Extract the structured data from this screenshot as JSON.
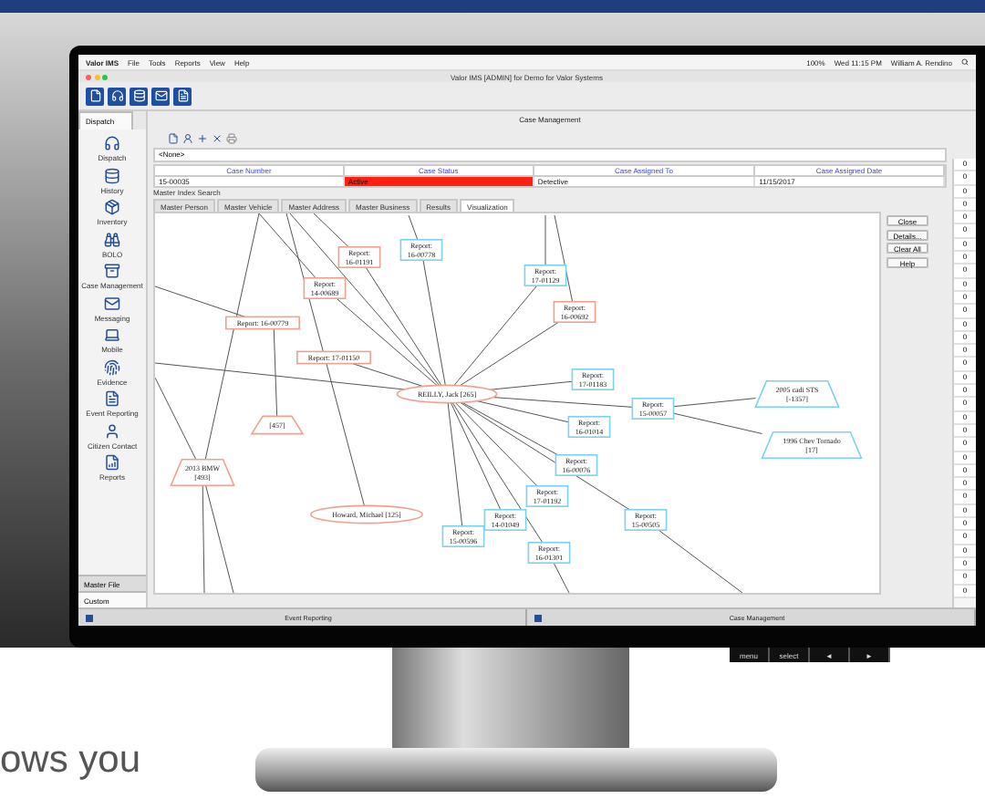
{
  "menubar": {
    "items": [
      "Valor IMS",
      "File",
      "Tools",
      "Reports",
      "View",
      "Help"
    ],
    "status": [
      "100%",
      "Wed 11:15 PM",
      "William A. Rendino"
    ]
  },
  "window": {
    "title": "Valor IMS [ADMIN] for Demo for Valor Systems"
  },
  "sidebar": {
    "tabs": [
      {
        "label": "Dispatch",
        "selected": true
      }
    ],
    "items": [
      "Dispatch",
      "History",
      "Inventory",
      "BOLO",
      "Case Management",
      "Messaging",
      "Mobile",
      "Evidence",
      "Event Reporting",
      "Citizen Contact",
      "Reports"
    ],
    "bottom_tabs": [
      {
        "label": "Master File",
        "selected": false
      },
      {
        "label": "Custom",
        "selected": true
      }
    ]
  },
  "case_management": {
    "title": "Case Management",
    "filter": "<None>",
    "columns": [
      "Case Number",
      "Case Status",
      "Case Assigned To",
      "Case Assigned Date"
    ],
    "rows": [
      {
        "cells": [
          "15-00035",
          "Active",
          "Detective",
          "11/15/2017"
        ],
        "color": "#ff2010"
      }
    ],
    "search_title": "Master Index Search",
    "tabs": [
      {
        "label": "Master Person",
        "selected": false
      },
      {
        "label": "Master Vehicle",
        "selected": false
      },
      {
        "label": "Master Address",
        "selected": false
      },
      {
        "label": "Master Business",
        "selected": false
      },
      {
        "label": "Results",
        "selected": false
      },
      {
        "label": "Visualization",
        "selected": true
      }
    ],
    "buttons": [
      "Close",
      "Details...",
      "Clear All",
      "Help"
    ],
    "counts": [
      "0",
      "0",
      "0",
      "0",
      "0",
      "0",
      "0",
      "0",
      "0",
      "0",
      "0",
      "0",
      "0",
      "0",
      "0",
      "0",
      "0",
      "0",
      "0",
      "0",
      "0",
      "0",
      "0",
      "0",
      "0",
      "0",
      "0",
      "0",
      "0",
      "0",
      "0",
      "0",
      "0"
    ]
  },
  "graph": {
    "nodes": [
      {
        "kind": "box",
        "lines": [
          "Report:",
          "16-01191"
        ],
        "color": "#f0a08c"
      },
      {
        "kind": "box",
        "lines": [
          "Report:",
          "16-00778"
        ],
        "color": "#78d2f0"
      },
      {
        "kind": "box",
        "lines": [
          "Report:",
          "14-00689"
        ],
        "color": "#f0a08c"
      },
      {
        "kind": "box",
        "lines": [
          "Report: 16-00779"
        ],
        "color": "#f0a08c"
      },
      {
        "kind": "box",
        "lines": [
          "Report: 17-01150"
        ],
        "color": "#f0a08c"
      },
      {
        "kind": "ellipse",
        "lines": [
          "REILLY, Jack [265]"
        ],
        "color": "#f0a08c"
      },
      {
        "kind": "trapezoid",
        "lines": [
          "[457]"
        ],
        "color": "#f0a08c"
      },
      {
        "kind": "trapezoid",
        "lines": [
          "2013 BMW",
          "[493]"
        ],
        "color": "#f0a08c"
      },
      {
        "kind": "ellipse",
        "lines": [
          "Howard, Michael [125]"
        ],
        "color": "#f0a08c"
      },
      {
        "kind": "box",
        "lines": [
          "Report:",
          "15-00596"
        ],
        "color": "#78d2f0"
      },
      {
        "kind": "box",
        "lines": [
          "Report:",
          "14-01049"
        ],
        "color": "#78d2f0"
      },
      {
        "kind": "box",
        "lines": [
          "Report:",
          "17-01129"
        ],
        "color": "#78d2f0"
      },
      {
        "kind": "box",
        "lines": [
          "Report:",
          "16-00692"
        ],
        "color": "#f0a08c"
      },
      {
        "kind": "box",
        "lines": [
          "Report:",
          "17-01183"
        ],
        "color": "#78d2f0"
      },
      {
        "kind": "box",
        "lines": [
          "Report:",
          "15-00057"
        ],
        "color": "#78d2f0"
      },
      {
        "kind": "box",
        "lines": [
          "Report:",
          "16-01014"
        ],
        "color": "#78d2f0"
      },
      {
        "kind": "box",
        "lines": [
          "Report:",
          "16-00076"
        ],
        "color": "#78d2f0"
      },
      {
        "kind": "box",
        "lines": [
          "Report:",
          "17-01192"
        ],
        "color": "#78d2f0"
      },
      {
        "kind": "box",
        "lines": [
          "Report:",
          "16-01301"
        ],
        "color": "#78d2f0"
      },
      {
        "kind": "box",
        "lines": [
          "Report:",
          "15-00505"
        ],
        "color": "#78d2f0"
      },
      {
        "kind": "trapezoid",
        "lines": [
          "2005 cadi STS",
          "[-1357]"
        ],
        "color": "#78d2f0"
      },
      {
        "kind": "trapezoid",
        "lines": [
          "1996 Chev Tornado",
          "[17]"
        ],
        "color": "#78d2f0"
      }
    ]
  },
  "bottom_bar": [
    "Event Reporting",
    "Case Management"
  ],
  "monitor_buttons": [
    "menu",
    "select",
    "◄",
    "►"
  ],
  "caption": "ows you"
}
